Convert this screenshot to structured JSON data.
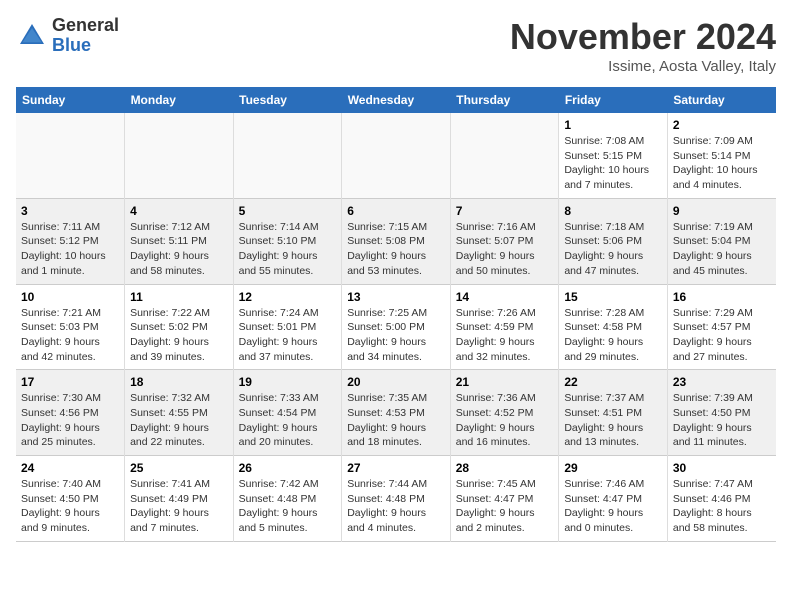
{
  "logo": {
    "general": "General",
    "blue": "Blue"
  },
  "title": "November 2024",
  "location": "Issime, Aosta Valley, Italy",
  "days_header": [
    "Sunday",
    "Monday",
    "Tuesday",
    "Wednesday",
    "Thursday",
    "Friday",
    "Saturday"
  ],
  "weeks": [
    [
      {
        "day": "",
        "info": ""
      },
      {
        "day": "",
        "info": ""
      },
      {
        "day": "",
        "info": ""
      },
      {
        "day": "",
        "info": ""
      },
      {
        "day": "",
        "info": ""
      },
      {
        "day": "1",
        "info": "Sunrise: 7:08 AM\nSunset: 5:15 PM\nDaylight: 10 hours and 7 minutes."
      },
      {
        "day": "2",
        "info": "Sunrise: 7:09 AM\nSunset: 5:14 PM\nDaylight: 10 hours and 4 minutes."
      }
    ],
    [
      {
        "day": "3",
        "info": "Sunrise: 7:11 AM\nSunset: 5:12 PM\nDaylight: 10 hours and 1 minute."
      },
      {
        "day": "4",
        "info": "Sunrise: 7:12 AM\nSunset: 5:11 PM\nDaylight: 9 hours and 58 minutes."
      },
      {
        "day": "5",
        "info": "Sunrise: 7:14 AM\nSunset: 5:10 PM\nDaylight: 9 hours and 55 minutes."
      },
      {
        "day": "6",
        "info": "Sunrise: 7:15 AM\nSunset: 5:08 PM\nDaylight: 9 hours and 53 minutes."
      },
      {
        "day": "7",
        "info": "Sunrise: 7:16 AM\nSunset: 5:07 PM\nDaylight: 9 hours and 50 minutes."
      },
      {
        "day": "8",
        "info": "Sunrise: 7:18 AM\nSunset: 5:06 PM\nDaylight: 9 hours and 47 minutes."
      },
      {
        "day": "9",
        "info": "Sunrise: 7:19 AM\nSunset: 5:04 PM\nDaylight: 9 hours and 45 minutes."
      }
    ],
    [
      {
        "day": "10",
        "info": "Sunrise: 7:21 AM\nSunset: 5:03 PM\nDaylight: 9 hours and 42 minutes."
      },
      {
        "day": "11",
        "info": "Sunrise: 7:22 AM\nSunset: 5:02 PM\nDaylight: 9 hours and 39 minutes."
      },
      {
        "day": "12",
        "info": "Sunrise: 7:24 AM\nSunset: 5:01 PM\nDaylight: 9 hours and 37 minutes."
      },
      {
        "day": "13",
        "info": "Sunrise: 7:25 AM\nSunset: 5:00 PM\nDaylight: 9 hours and 34 minutes."
      },
      {
        "day": "14",
        "info": "Sunrise: 7:26 AM\nSunset: 4:59 PM\nDaylight: 9 hours and 32 minutes."
      },
      {
        "day": "15",
        "info": "Sunrise: 7:28 AM\nSunset: 4:58 PM\nDaylight: 9 hours and 29 minutes."
      },
      {
        "day": "16",
        "info": "Sunrise: 7:29 AM\nSunset: 4:57 PM\nDaylight: 9 hours and 27 minutes."
      }
    ],
    [
      {
        "day": "17",
        "info": "Sunrise: 7:30 AM\nSunset: 4:56 PM\nDaylight: 9 hours and 25 minutes."
      },
      {
        "day": "18",
        "info": "Sunrise: 7:32 AM\nSunset: 4:55 PM\nDaylight: 9 hours and 22 minutes."
      },
      {
        "day": "19",
        "info": "Sunrise: 7:33 AM\nSunset: 4:54 PM\nDaylight: 9 hours and 20 minutes."
      },
      {
        "day": "20",
        "info": "Sunrise: 7:35 AM\nSunset: 4:53 PM\nDaylight: 9 hours and 18 minutes."
      },
      {
        "day": "21",
        "info": "Sunrise: 7:36 AM\nSunset: 4:52 PM\nDaylight: 9 hours and 16 minutes."
      },
      {
        "day": "22",
        "info": "Sunrise: 7:37 AM\nSunset: 4:51 PM\nDaylight: 9 hours and 13 minutes."
      },
      {
        "day": "23",
        "info": "Sunrise: 7:39 AM\nSunset: 4:50 PM\nDaylight: 9 hours and 11 minutes."
      }
    ],
    [
      {
        "day": "24",
        "info": "Sunrise: 7:40 AM\nSunset: 4:50 PM\nDaylight: 9 hours and 9 minutes."
      },
      {
        "day": "25",
        "info": "Sunrise: 7:41 AM\nSunset: 4:49 PM\nDaylight: 9 hours and 7 minutes."
      },
      {
        "day": "26",
        "info": "Sunrise: 7:42 AM\nSunset: 4:48 PM\nDaylight: 9 hours and 5 minutes."
      },
      {
        "day": "27",
        "info": "Sunrise: 7:44 AM\nSunset: 4:48 PM\nDaylight: 9 hours and 4 minutes."
      },
      {
        "day": "28",
        "info": "Sunrise: 7:45 AM\nSunset: 4:47 PM\nDaylight: 9 hours and 2 minutes."
      },
      {
        "day": "29",
        "info": "Sunrise: 7:46 AM\nSunset: 4:47 PM\nDaylight: 9 hours and 0 minutes."
      },
      {
        "day": "30",
        "info": "Sunrise: 7:47 AM\nSunset: 4:46 PM\nDaylight: 8 hours and 58 minutes."
      }
    ]
  ]
}
